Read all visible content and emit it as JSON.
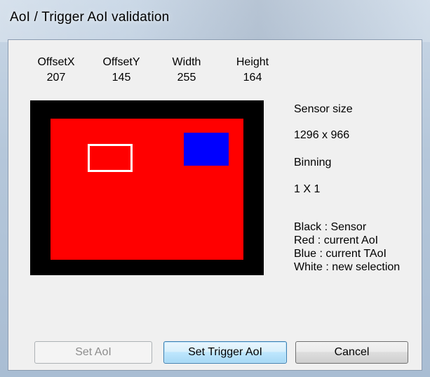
{
  "window": {
    "title": "AoI / Trigger AoI validation"
  },
  "fields": [
    {
      "label": "OffsetX",
      "value": "207"
    },
    {
      "label": "OffsetY",
      "value": "145"
    },
    {
      "label": "Width",
      "value": "255"
    },
    {
      "label": "Height",
      "value": "164"
    }
  ],
  "info": {
    "sensor_size_label": "Sensor size",
    "sensor_size_value": "1296 x 966",
    "binning_label": "Binning",
    "binning_value": "1 X 1"
  },
  "legend": [
    "Black : Sensor",
    "Red : current AoI",
    "Blue : current TAoI",
    "White : new selection"
  ],
  "preview_colors": {
    "sensor": "#000000",
    "current_aoi": "#ff0000",
    "current_taoi": "#0000ff",
    "new_selection": "#ffffff"
  },
  "buttons": {
    "set_aoi": {
      "label": "Set AoI",
      "enabled": false
    },
    "set_trigger_aoi": {
      "label": "Set Trigger AoI",
      "enabled": true,
      "default": true
    },
    "cancel": {
      "label": "Cancel",
      "enabled": true
    }
  }
}
